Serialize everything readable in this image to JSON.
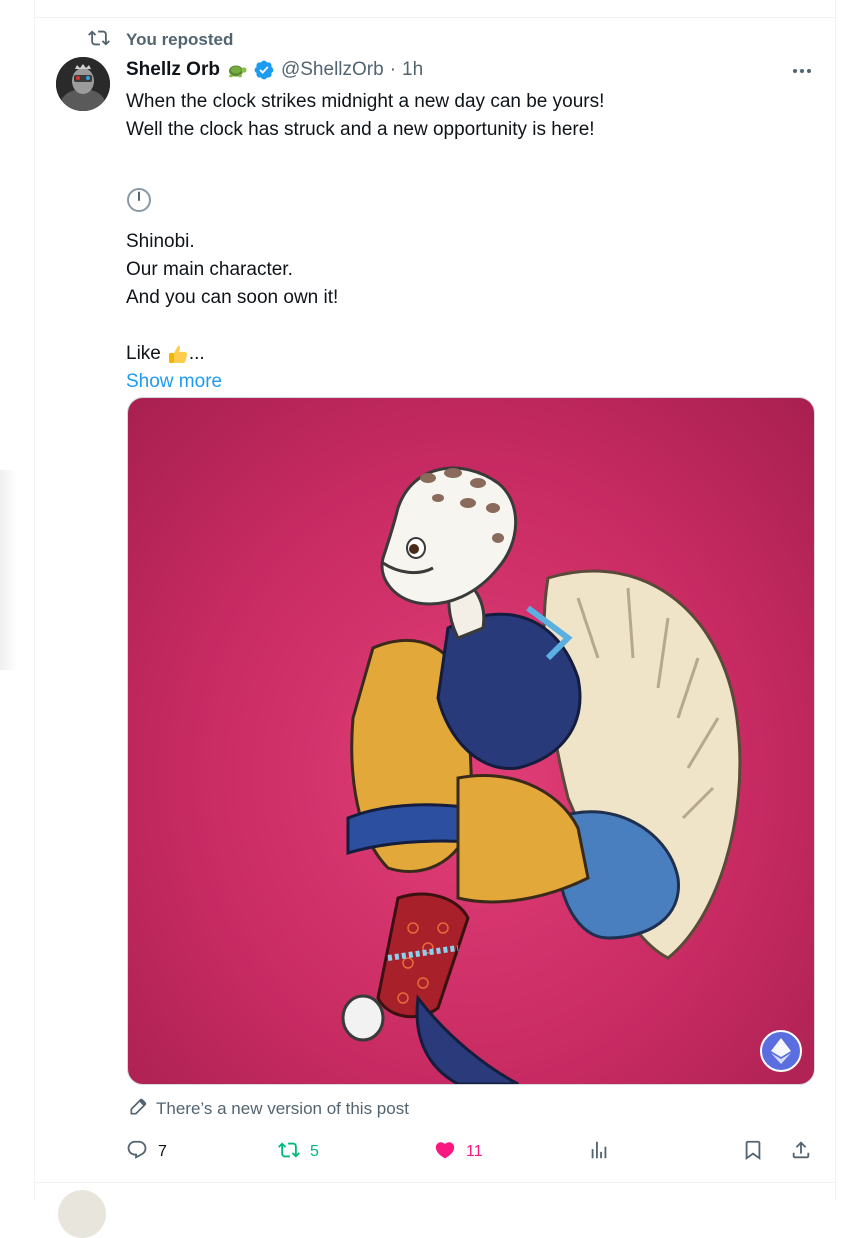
{
  "repost": {
    "label": "You reposted"
  },
  "tweet": {
    "name": "Shellz Orb",
    "name_emoji": "turtle",
    "handle": "@ShellzOrb",
    "separator": "·",
    "time": "1h",
    "lines": {
      "l1": "When the clock strikes midnight a new day can be yours!",
      "l2": "Well the clock has struck and a new opportunity is here!",
      "l3": "Shinobi.",
      "l4": "Our main character.",
      "l5": "And you can soon own it!",
      "l6_text": "Like",
      "l6_ellipsis": "..."
    },
    "show_more": "Show more",
    "new_version_notice": "There’s a new version of this post",
    "stats": {
      "replies": "7",
      "reposts": "5",
      "likes": "11"
    }
  },
  "colors": {
    "accent": "#1d9bf0",
    "retweet_active": "#00ba7c",
    "like_active": "#f91880",
    "muted": "#536471",
    "media_bg": "#c92b63"
  },
  "icons": {
    "repost": "repost-icon",
    "verified": "verified-badge-icon",
    "more": "more-icon",
    "clock": "clock-emoji-icon",
    "thumbs_up": "thumbs-up-emoji-icon",
    "edit": "pencil-edit-icon",
    "reply": "reply-icon",
    "retweet": "retweet-icon",
    "like": "heart-icon",
    "views": "analytics-icon",
    "bookmark": "bookmark-icon",
    "share": "share-icon",
    "ethereum": "ethereum-icon"
  }
}
